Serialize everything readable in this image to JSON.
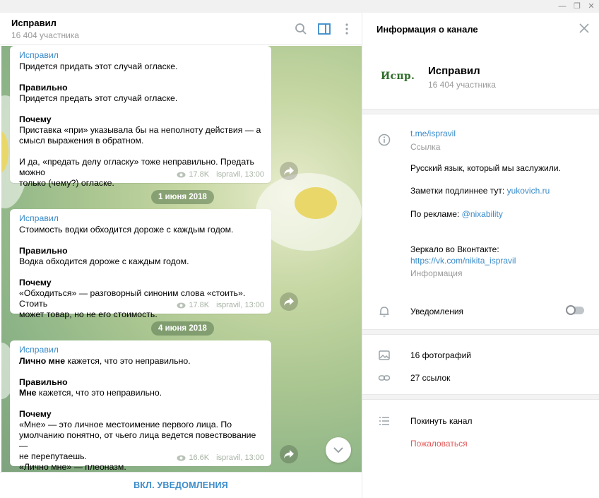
{
  "chat": {
    "title": "Исправил",
    "subtitle": "16 404 участника"
  },
  "messages": [
    {
      "author": "Исправил",
      "lines": [
        "Придется придать этот случай огласке.",
        "",
        "Правильно",
        "Придется предать этот случай огласке.",
        "",
        "Почему",
        "Приставка «при» указывала бы на неполноту действия — а",
        "смысл выражения в обратном.",
        "",
        "И да, «предать делу огласку» тоже неправильно. Предать можно",
        "только (чему?) огласке."
      ],
      "views": "17.8K",
      "signature": "ispravil, 13:00"
    },
    {
      "author": "Исправил",
      "lines": [
        "Стоимость водки обходится дороже с каждым годом.",
        "",
        "Правильно",
        "Водка обходится дороже с каждым годом.",
        "",
        "Почему",
        "«Обходиться» — разговорный синоним слова «стоить». Стоить",
        "может товар, но не его стоимость."
      ],
      "views": "17.8K",
      "signature": "ispravil, 13:00"
    },
    {
      "author": "Исправил",
      "lines": [
        "Лично мне кажется, что это неправильно.",
        "",
        "Правильно",
        "Мне кажется, что это неправильно.",
        "",
        "Почему",
        "«Мне» — это личное местоимение первого лица. По",
        "умолчанию понятно, от чьего лица ведется повествование —",
        "не перепутаешь.",
        "«Лично мне» — плеоназм."
      ],
      "views": "16.6K",
      "signature": "ispravil, 13:00"
    }
  ],
  "dates": [
    "1 июня 2018",
    "4 июня 2018"
  ],
  "bottom_bar": {
    "label": "ВКЛ. УВЕДОМЛЕНИЯ"
  },
  "panel": {
    "title": "Информация о канале",
    "logo_text": "Испр.",
    "name": "Исправил",
    "members": "16 404 участника",
    "link": "t.me/ispravil",
    "link_caption": "Ссылка",
    "description_line1": "Русский язык, который мы заслужили.",
    "notes_prefix": "Заметки подлиннее тут: ",
    "notes_link": "yukovich.ru",
    "ads_prefix": "По рекламе: ",
    "ads_link": "@nixability",
    "mirror_label": "Зеркало во Вконтакте:",
    "mirror_link": "https://vk.com/nikita_ispravil",
    "info_caption": "Информация",
    "notifications": "Уведомления",
    "notifications_on": false,
    "photos": "16 фотографий",
    "links": "27 ссылок",
    "leave": "Покинуть канал",
    "report": "Пожаловаться"
  },
  "colors": {
    "accent": "#3a8bc9",
    "danger": "#e05b5b",
    "logo": "#2f6e2a"
  }
}
